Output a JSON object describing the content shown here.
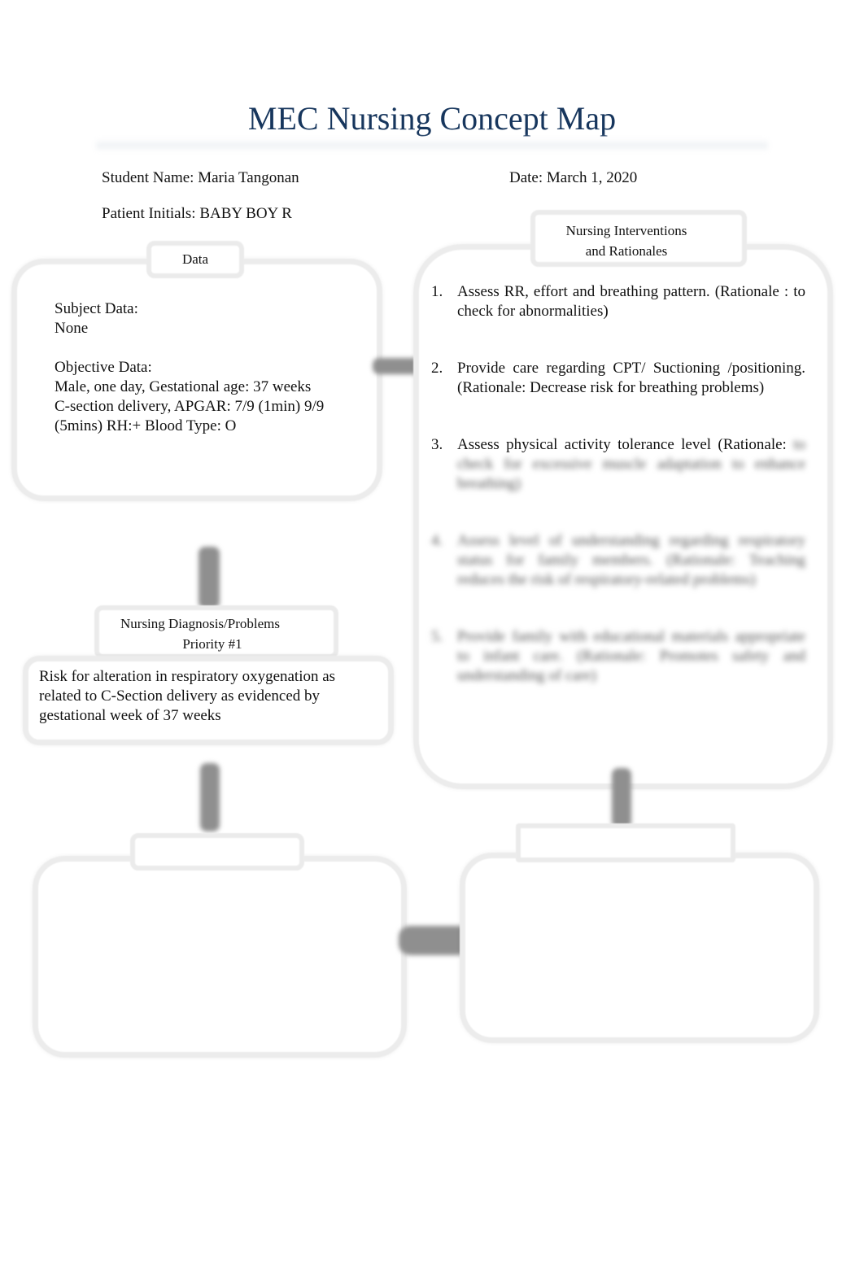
{
  "document": {
    "title": "MEC Nursing Concept Map",
    "student_name": "Student Name: Maria Tangonan",
    "date": "Date: March 1, 2020",
    "patient_initials": "Patient Initials: BABY BOY R"
  },
  "data_box": {
    "tab_label": "Data",
    "subjective_heading": "Subject Data:",
    "subjective_value": "None",
    "objective_heading": "Objective Data:",
    "objective_lines": [
      "Male, one day, Gestational age: 37 weeks",
      "C-section delivery, APGAR: 7/9 (1min) 9/9",
      "(5mins) RH:+ Blood Type: O"
    ]
  },
  "diagnosis_box": {
    "tab_label_line1": "Nursing Diagnosis/Problems",
    "tab_label_line2": "Priority #1",
    "text": "Risk for alteration in respiratory oxygenation as related to C-Section delivery as evidenced by gestational week of 37 weeks"
  },
  "interventions_box": {
    "tab_label_line1": "Nursing Interventions",
    "tab_label_line2": "and Rationales",
    "items": [
      {
        "num": "1.",
        "text": "Assess RR, effort and breathing pattern. (Rationale : to check for abnormalities)"
      },
      {
        "num": "2.",
        "text": "Provide care regarding CPT/ Suctioning /positioning. (Rationale: Decrease risk for breathing problems)"
      },
      {
        "num": "3.",
        "text": "Assess physical activity tolerance level (Rationale:",
        "hidden_tail": "to check for excessive muscle adaptation to enhance breathing)"
      },
      {
        "num": "4.",
        "hidden": "Assess level of understanding regarding respiratory status for family members. (Rationale: Teaching reduces the risk of respiratory-related problems)"
      },
      {
        "num": "5.",
        "hidden": "Provide family with educational materials appropriate to infant care. (Rationale: Promotes safety and understanding of care)"
      }
    ]
  },
  "bottom_left_box": {
    "tab_label": ""
  },
  "bottom_right_box": {
    "tab_label": ""
  },
  "colors": {
    "title": "#17365d",
    "box_border": "#ececec",
    "connector": "#8f8f8f"
  }
}
